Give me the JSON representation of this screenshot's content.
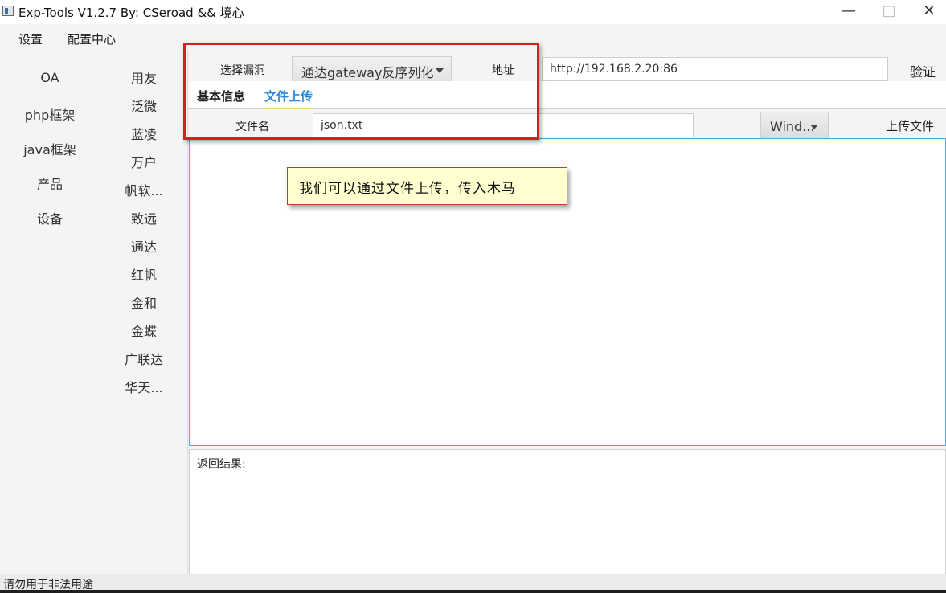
{
  "window": {
    "title": "Exp-Tools V1.2.7   By: CSeroad && 境心",
    "minimize_glyph": "—",
    "maximize_glyph": "□",
    "close_glyph": "✕"
  },
  "menu": {
    "items": [
      "设置",
      "配置中心"
    ]
  },
  "categories": [
    "OA",
    "php框架",
    "java框架",
    "产品",
    "设备"
  ],
  "vendors": [
    "用友",
    "泛微",
    "蓝凌",
    "万户",
    "帆软...",
    "致远",
    "通达",
    "红帆",
    "金和",
    "金蝶",
    "广联达",
    "华天..."
  ],
  "form": {
    "vuln_label": "选择漏洞",
    "vuln_selected": "通达gateway反序列化",
    "address_label": "地址",
    "address_value": "http://192.168.2.20:86",
    "verify_button": "验证"
  },
  "tabs": [
    "基本信息",
    "文件上传"
  ],
  "active_tab": "文件上传",
  "upload": {
    "filename_label": "文件名",
    "filename_value": "json.txt",
    "os_selected": "Wind...",
    "upload_button": "上传文件"
  },
  "result": {
    "label": "返回结果:"
  },
  "annotation": {
    "callout_text": "我们可以通过文件上传，传入木马",
    "highlight_color": "#d21f1f"
  },
  "status": {
    "text": "请勿用于非法用途"
  },
  "colors": {
    "accent": "#2b8ad8",
    "editor_border": "#57a8d9"
  }
}
